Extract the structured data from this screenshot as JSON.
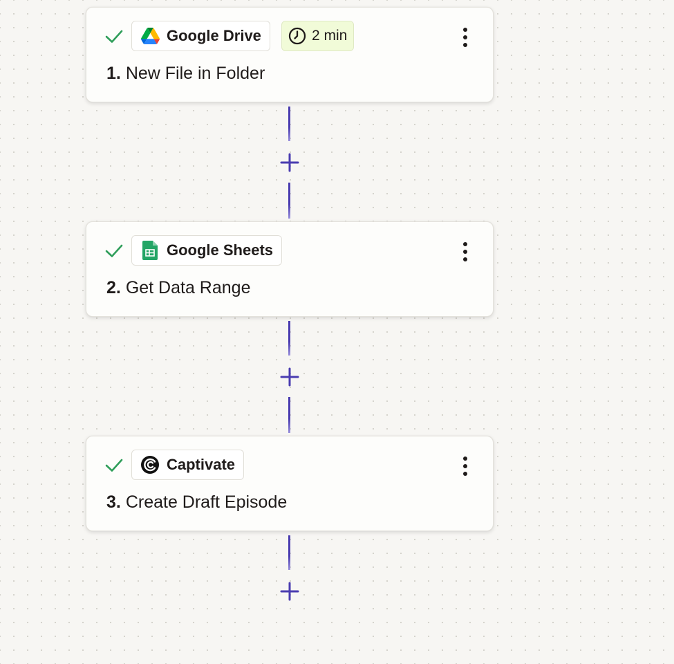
{
  "steps": [
    {
      "app": "Google Drive",
      "number": "1.",
      "title": "New File in Folder",
      "status": "check-icon",
      "time_badge": "2 min",
      "icon": "google-drive-icon"
    },
    {
      "app": "Google Sheets",
      "number": "2.",
      "title": "Get Data Range",
      "status": "check-icon",
      "icon": "google-sheets-icon"
    },
    {
      "app": "Captivate",
      "number": "3.",
      "title": "Create Draft Episode",
      "status": "check-icon",
      "icon": "captivate-icon"
    }
  ],
  "icons": {
    "add_step": "plus-icon",
    "more": "more-vertical-icon",
    "timer": "clock-icon"
  },
  "colors": {
    "canvas": "#f7f6f3",
    "card": "#fdfdfb",
    "check": "#2f9e5a",
    "connector": "#4a3cb0",
    "time_badge": "#f1fbd8"
  }
}
